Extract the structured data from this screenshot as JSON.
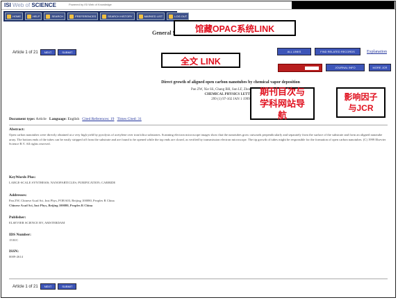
{
  "header": {
    "logo_bold": "ISI",
    "logo_light": "Web of",
    "logo_brand": "SCIENCE",
    "powered_by": "Powered by ISI Web of Knowledge"
  },
  "nav": {
    "items": [
      "HOME",
      "HELP",
      "SEARCH",
      "PREFERENCES",
      "SEARCH HISTORY",
      "MARKED LIST",
      "LOG OUT"
    ]
  },
  "page": {
    "heading": "General Search Results--Full Record",
    "article_pos": "Article 1 of 21",
    "prev_label": "NEXT",
    "next_label": "SUBMIT",
    "all_label": "ALL LINKS",
    "related_label": "FIND RELATED RECORDS",
    "explanation_link": "Explanation",
    "fulltext_label": "FULL TEXT",
    "journal_info_label": "JOURNAL INFO",
    "jcr_label": "MORE JCR"
  },
  "record": {
    "title": "Direct growth of aligned open carbon nanotubes by chemical vapor deposition",
    "authors": "Pan ZW, Xie SS, Chang BH, Sun LF, Zhou WY, Wang G",
    "journal": "CHEMICAL PHYSICS LETTERS",
    "citation": "299 (1) 97-102 JAN 1 1999",
    "doc_type_label": "Document type:",
    "doc_type": "Article",
    "language_label": "Language:",
    "language": "English",
    "cited_refs": "Cited References: 19",
    "times_cited": "Times Cited: 31",
    "abstract_label": "Abstract:",
    "abstract": "Open carbon nanotubes were directly obtained at a very high yield by pyrolysis of acetylene over iron/silica substrates. Scanning electron microscope images show that the nanotubes grow outwards perpendicularly and separately from the surface of the substrate and form an aligned nanotube array. The bottom ends of the tubes can be easily stripped off from the substrate and are found to be opened while the top ends are closed, as verified by transmission electron microscope. The tip growth of tubes might be responsible for the formation of open carbon nanotubes. (C) 1999 Elsevier Science B.V. All rights reserved.",
    "keywords_label": "KeyWords Plus:",
    "keywords": "LARGE-SCALE SYNTHESIS; NANOPARTICLES; PURIFICATION; CARBIDE",
    "addresses_label": "Addresses:",
    "address1": "Pan ZW, Chinese Acad Sci, Inst Phys, POB 603, Beijing 100080, Peoples R China",
    "address2": "Chinese Acad Sci, Inst Phys, Beijing 100080, Peoples R China",
    "publisher_label": "Publisher:",
    "publisher": "ELSEVIER SCIENCE BV, AMSTERDAM",
    "ids_label": "IDS Number:",
    "ids": "153UC",
    "issn_label": "ISSN:",
    "issn": "0009-2614"
  },
  "callouts": {
    "opac": "馆藏OPAC系统LINK",
    "fulltext": "全文 LINK",
    "journal": "期刊目次与学科网站导航",
    "jcr": "影响因子与JCR"
  },
  "colors": {
    "callout_text": "#e0101e",
    "nav_bg": "#1c2e63",
    "button_blue": "#3d55b8",
    "link_blue": "#1d2f9a"
  }
}
